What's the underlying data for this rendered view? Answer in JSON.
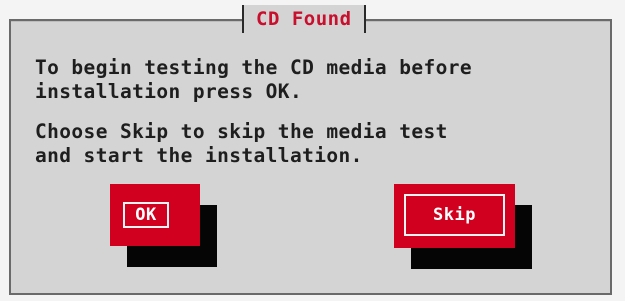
{
  "dialog": {
    "title": "CD Found",
    "message_line_1": "To begin testing the CD media before",
    "message_line_2": "installation press OK.",
    "message_line_3": "Choose Skip to skip the media test",
    "message_line_4": "and start the installation."
  },
  "buttons": {
    "ok_label": "OK",
    "skip_label": "Skip"
  },
  "colors": {
    "accent": "#d2001f",
    "title": "#c8102e",
    "dialog_bg": "#d4d4d4",
    "text": "#1e1e1e",
    "shadow": "#050505"
  }
}
